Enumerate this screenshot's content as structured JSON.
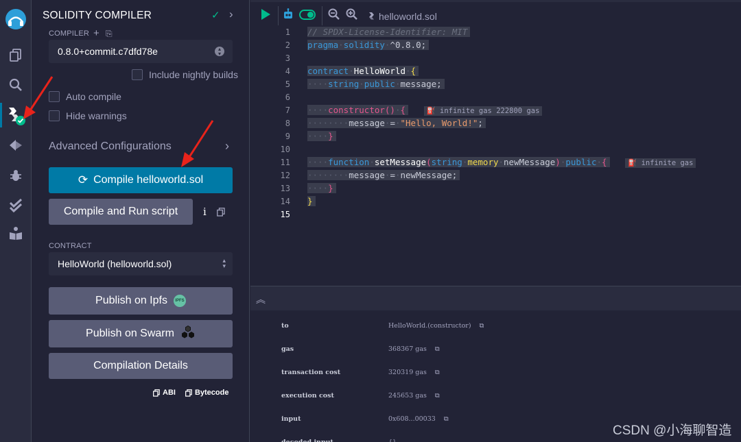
{
  "panel": {
    "title": "SOLIDITY COMPILER",
    "compiler_label": "COMPILER",
    "compiler_version": "0.8.0+commit.c7dfd78e",
    "include_nightly": "Include nightly builds",
    "auto_compile": "Auto compile",
    "hide_warnings": "Hide warnings",
    "advanced": "Advanced Configurations",
    "compile_button": "Compile helloworld.sol",
    "compile_run_button": "Compile and Run script",
    "info_glyph": "i",
    "contract_label": "CONTRACT",
    "contract_value": "HelloWorld (helloworld.sol)",
    "publish_ipfs": "Publish on Ipfs",
    "ipfs_badge": "IPFS",
    "publish_swarm": "Publish on Swarm",
    "compilation_details": "Compilation Details",
    "abi": "ABI",
    "bytecode": "Bytecode"
  },
  "toolbar": {
    "file_name": "helloworld.sol"
  },
  "editor": {
    "line_numbers": [
      "1",
      "2",
      "3",
      "4",
      "5",
      "6",
      "7",
      "8",
      "9",
      "10",
      "11",
      "12",
      "13",
      "14",
      "15"
    ],
    "current_line": "15",
    "lines": {
      "l1": "// SPDX-License-Identifier: MIT",
      "l2_kw": "pragma",
      "l2_kw2": "solidity",
      "l2_ver": "^0.8.0;",
      "l4_kw": "contract",
      "l4_name": "HelloWorld",
      "l4_brace": "{",
      "l5_type": "string",
      "l5_vis": "public",
      "l5_name": "message;",
      "l7_kw": "constructor",
      "l7_paren": "()",
      "l7_brace": "{",
      "l7_gas": "infinite gas 222800 gas",
      "l8_lhs": "message",
      "l8_eq": "=",
      "l8_str": "\"Hello, World!\"",
      "l8_end": ";",
      "l9_brace": "}",
      "l11_kw": "function",
      "l11_name": "setMessage",
      "l11_open": "(",
      "l11_type": "string",
      "l11_mem": "memory",
      "l11_param": "newMessage",
      "l11_close": ")",
      "l11_vis": "public",
      "l11_brace": "{",
      "l11_gas": "infinite gas",
      "l12_lhs": "message",
      "l12_eq": "=",
      "l12_rhs": "newMessage;",
      "l13_brace": "}",
      "l14_brace": "}"
    }
  },
  "terminal": {
    "rows": [
      {
        "key": "to",
        "value": "HelloWorld.(constructor)"
      },
      {
        "key": "gas",
        "value": "368367 gas"
      },
      {
        "key": "transaction cost",
        "value": "320319 gas"
      },
      {
        "key": "execution cost",
        "value": "245653 gas"
      },
      {
        "key": "input",
        "value": "0x608...00033"
      },
      {
        "key": "decoded input",
        "value": "{}"
      }
    ]
  },
  "watermark": "CSDN @小海聊智造",
  "colors": {
    "accent": "#007aa6",
    "success": "#00bc8c",
    "annotation_arrow": "#e8231b"
  }
}
